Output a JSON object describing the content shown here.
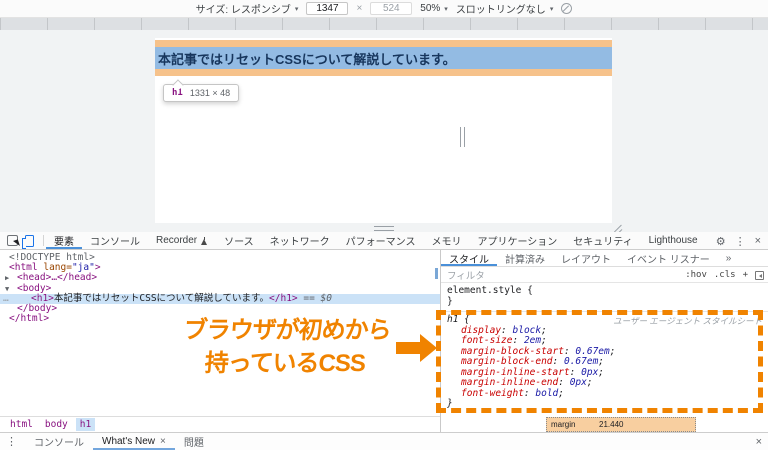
{
  "colors": {
    "annotation_orange": "#f08300",
    "margin_highlight": "#f6c28b",
    "content_highlight": "#93bbe3",
    "selection_blue": "#cbe2f7",
    "accent_blue": "#4a90d9"
  },
  "device_toolbar": {
    "size_label": "サイズ: レスポンシブ",
    "width_value": "1347",
    "multiply": "×",
    "height_value": "524",
    "zoom_value": "50%",
    "throttling_value": "スロットリングなし",
    "caret": "▾"
  },
  "page": {
    "h1_text": "本記事ではリセットCSSについて解説しています。",
    "tooltip": {
      "tag": "h1",
      "dimensions": "1331 × 48"
    }
  },
  "devtools": {
    "tabs": [
      "要素",
      "コンソール",
      "Recorder",
      "ソース",
      "ネットワーク",
      "パフォーマンス",
      "メモリ",
      "アプリケーション",
      "セキュリティ",
      "Lighthouse"
    ],
    "icons": {
      "gear": "⚙",
      "more": "⋮",
      "close": "×"
    }
  },
  "dom": {
    "gutter_dots": "…",
    "expander_collapsed": "▶",
    "expander_expanded": "▼",
    "doctype": "<!DOCTYPE html>",
    "html_open": "<html",
    "lang_attr": "lang=",
    "lang_value": "\"ja\"",
    "bracket_close": ">",
    "head_line": "<head>…</head>",
    "body_open": "<body>",
    "h1_open": "<h1>",
    "h1_text": "本記事ではリセットCSSについて解説しています。",
    "h1_close": "</h1>",
    "selected_hint": "== $0",
    "body_close": "</body>",
    "html_close": "</html>",
    "breadcrumb": [
      "html",
      "body",
      "h1"
    ]
  },
  "styles": {
    "tabs": [
      "スタイル",
      "計算済み",
      "レイアウト",
      "イベント リスナー"
    ],
    "tabs_overflow": "»",
    "filter_placeholder": "フィルタ",
    "pseudo_toggle": ":hov",
    "class_toggle": ".cls",
    "new_rule": "+",
    "element_style_open": "element.style {",
    "element_style_close": "}",
    "ua_rule": {
      "selector": "h1 {",
      "origin": "ユーザー エージェント スタイルシート",
      "close": "}",
      "declarations": [
        {
          "prop": "display",
          "value": "block"
        },
        {
          "prop": "font-size",
          "value": "2em"
        },
        {
          "prop": "margin-block-start",
          "value": "0.67em"
        },
        {
          "prop": "margin-block-end",
          "value": "0.67em"
        },
        {
          "prop": "margin-inline-start",
          "value": "0px"
        },
        {
          "prop": "margin-inline-end",
          "value": "0px"
        },
        {
          "prop": "font-weight",
          "value": "bold"
        }
      ]
    },
    "box_model": {
      "margin_label": "margin",
      "margin_top_value": "21.440"
    }
  },
  "drawer": {
    "kebab": "⋮",
    "tabs": [
      "コンソール",
      "What's New",
      "問題"
    ],
    "whats_new_close": "×",
    "close": "×"
  },
  "annotation": {
    "line1": "ブラウザが初めから",
    "line2": "持っているCSS"
  }
}
